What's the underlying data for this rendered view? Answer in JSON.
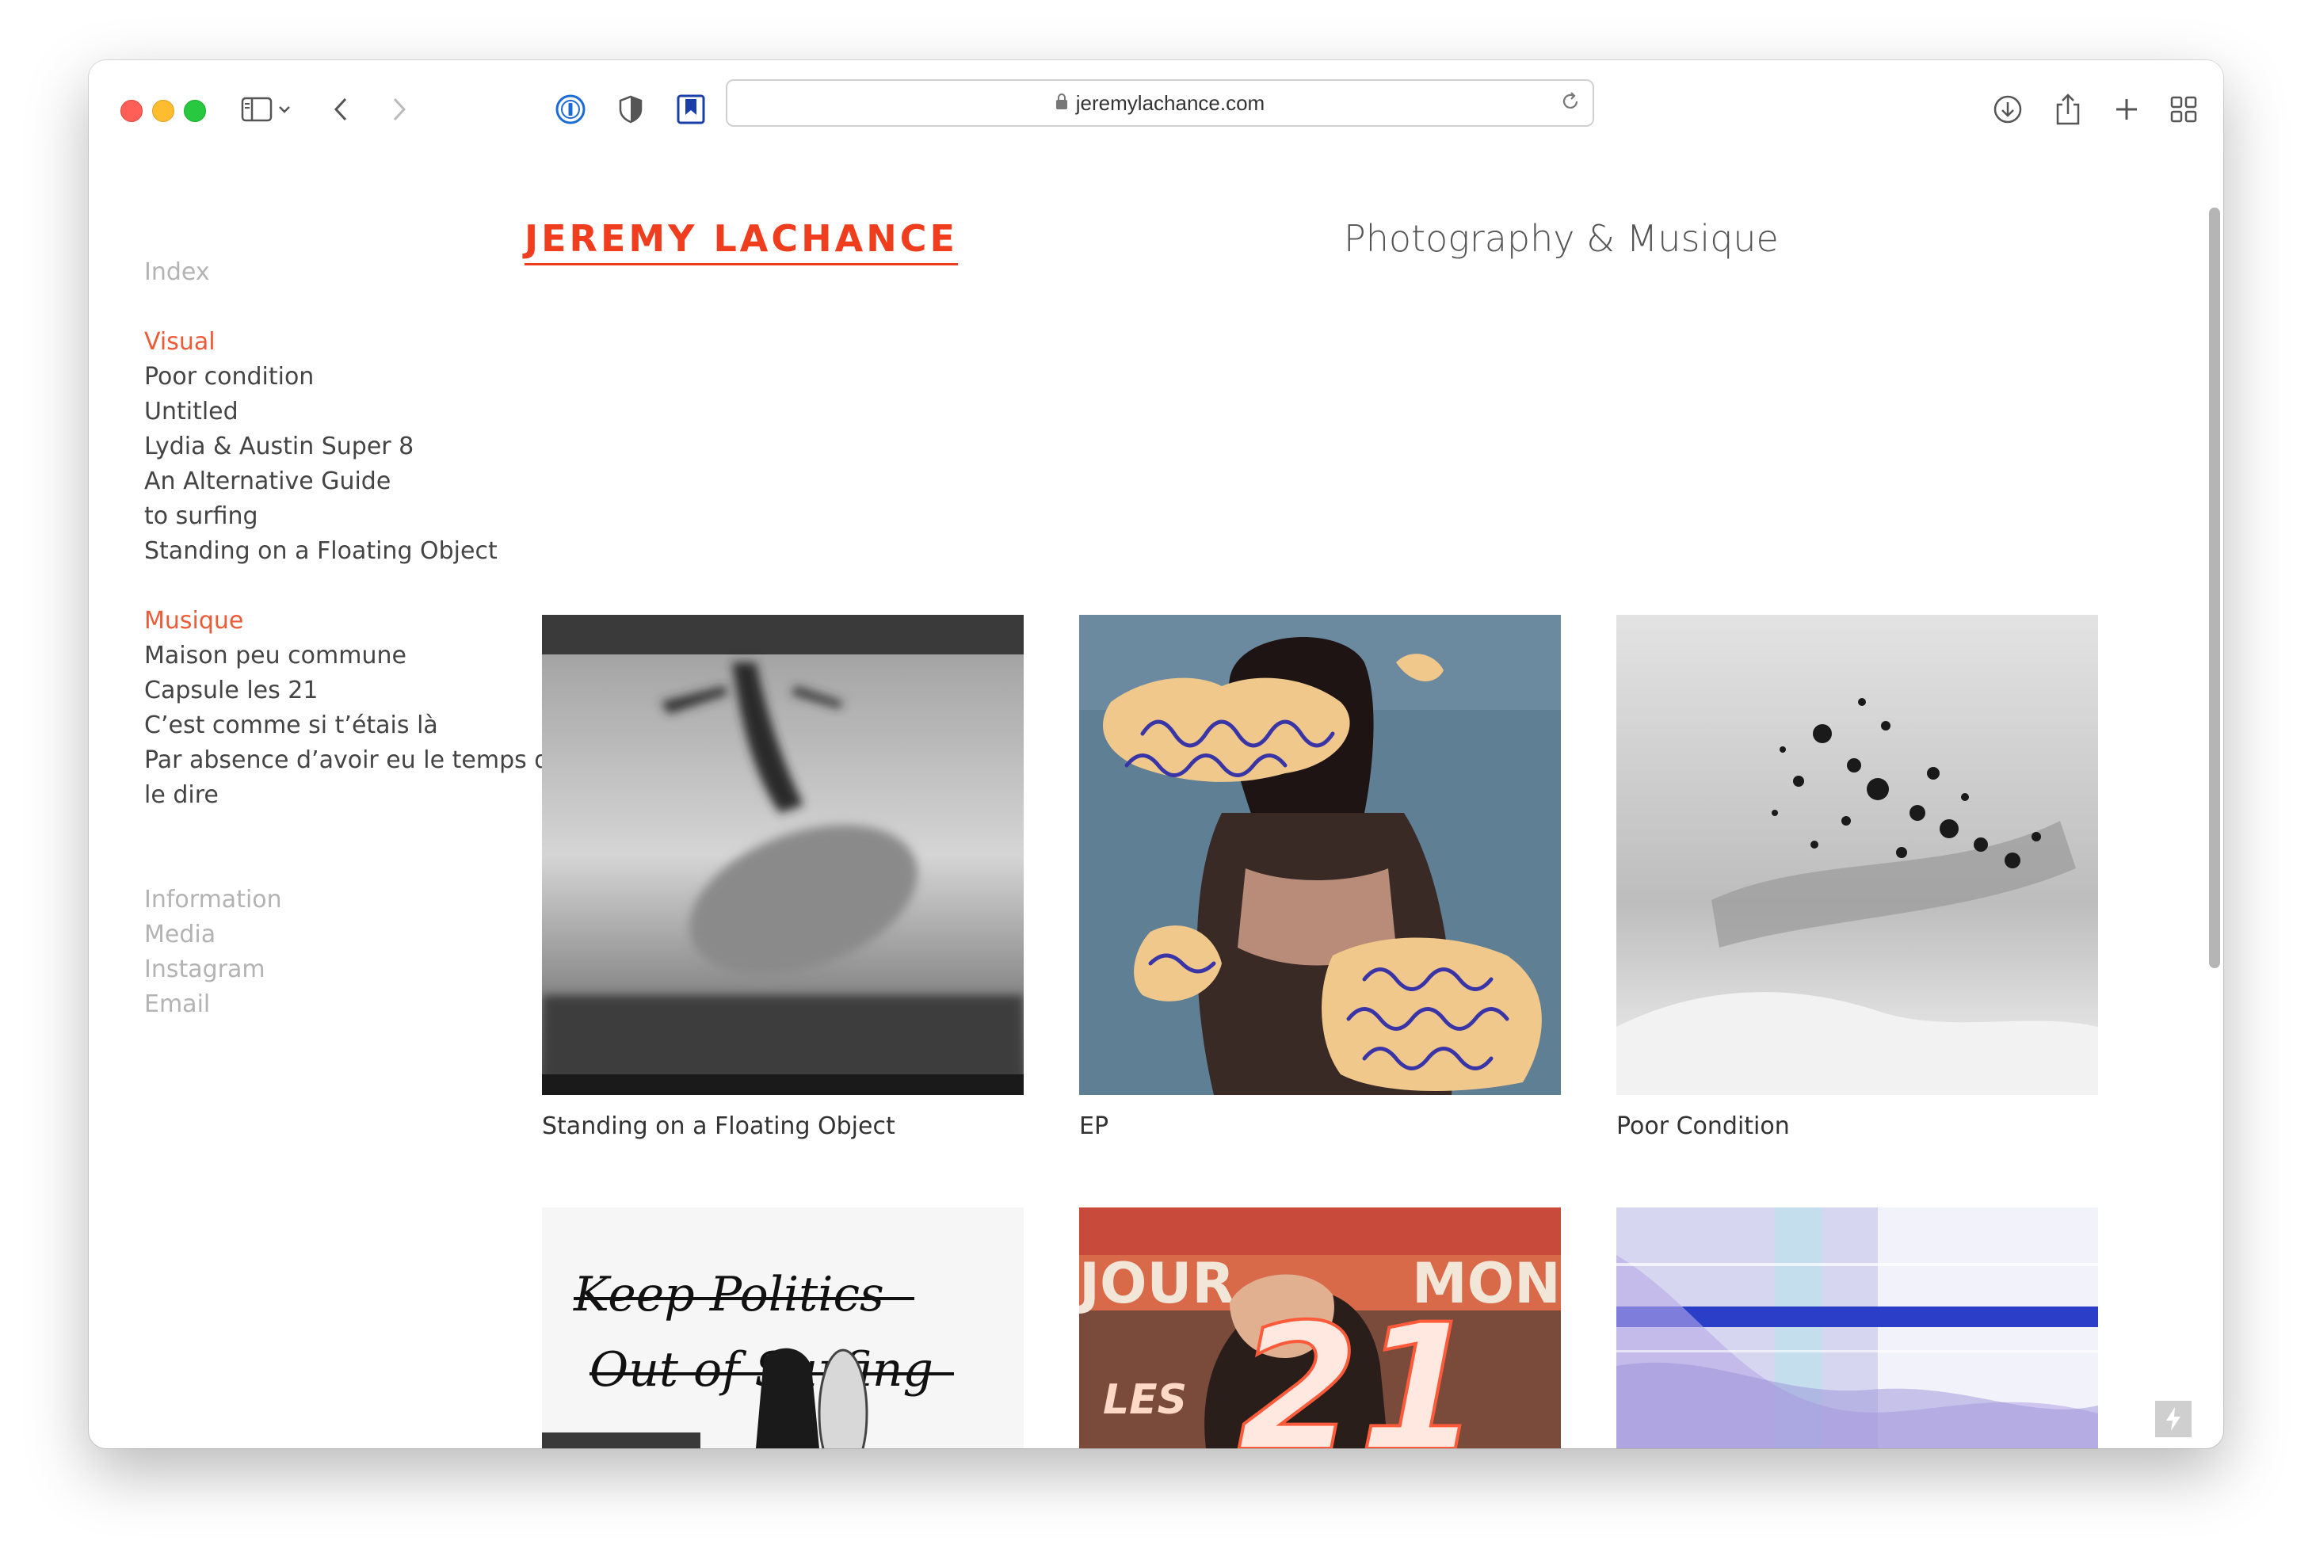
{
  "browser": {
    "url": "jeremylachance.com",
    "icons": [
      "sidebar-icon",
      "chevron-down-icon",
      "back-icon",
      "forward-icon",
      "password-manager-icon",
      "shield-icon",
      "bookmark-icon",
      "lock-icon",
      "reload-icon",
      "download-icon",
      "share-icon",
      "new-tab-icon",
      "tab-overview-icon"
    ]
  },
  "header": {
    "brand": "JEREMY LACHANCE",
    "tagline": "Photography & Musique",
    "brand_color": "#ef3d1e"
  },
  "sidebar": {
    "index": "Index",
    "visual_heading": "Visual",
    "visual_items": [
      "Poor condition",
      "Untitled",
      "Lydia & Austin Super 8",
      "An Alternative Guide",
      "to surfing",
      "Standing on a Floating Object"
    ],
    "musique_heading": "Musique",
    "musique_items": [
      "Maison peu commune",
      "Capsule les 21",
      "C’est comme si t’étais là",
      "Par absence d’avoir eu le temps de",
      "le dire"
    ],
    "footer_items": [
      "Information",
      "Media",
      "Instagram",
      "Email"
    ]
  },
  "gallery": [
    {
      "caption": "Standing on a Floating Object"
    },
    {
      "caption": "EP"
    },
    {
      "caption": "Poor Condition"
    },
    {
      "caption": ""
    },
    {
      "caption": ""
    },
    {
      "caption": ""
    }
  ],
  "artwork_text": {
    "keep_politics": "Keep Politics",
    "out_of_surfing": "Out of Surfing",
    "les": "LES",
    "twenty_one": "21",
    "jour": "JOUR",
    "montr": "MONTR"
  }
}
